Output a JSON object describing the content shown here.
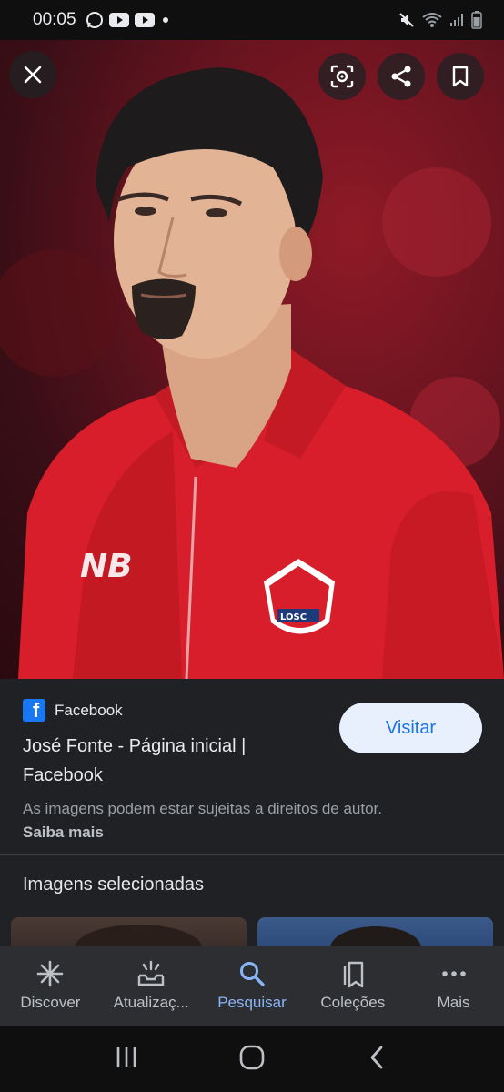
{
  "status_bar": {
    "time": "00:05",
    "app_icons": [
      "whatsapp-icon",
      "youtube-icon",
      "youtube-icon",
      "dot-icon"
    ],
    "right_icons": [
      "mute-icon",
      "wifi-icon",
      "signal-icon",
      "battery-icon"
    ]
  },
  "viewer": {
    "buttons": [
      "close-icon",
      "lens-icon",
      "share-icon",
      "bookmark-icon"
    ],
    "image_description_colors": {
      "jersey": "#d81e2a",
      "background": "#6a1420"
    }
  },
  "result": {
    "source_name": "Facebook",
    "title": "José Fonte - Página inicial | Facebook",
    "visit_label": "Visitar",
    "copyright_text": "As imagens podem estar sujeitas a direitos de autor.",
    "learn_more_label": "Saiba mais"
  },
  "related": {
    "heading": "Imagens selecionadas"
  },
  "bottom_nav": {
    "items": [
      {
        "label": "Discover",
        "icon": "asterisk-icon"
      },
      {
        "label": "Atualizaç...",
        "icon": "updates-icon"
      },
      {
        "label": "Pesquisar",
        "icon": "search-icon"
      },
      {
        "label": "Coleções",
        "icon": "collections-icon"
      },
      {
        "label": "Mais",
        "icon": "more-icon"
      }
    ],
    "active_index": 2
  },
  "colors": {
    "accent": "#8ab4f8",
    "visit_bg": "#e8f0fe",
    "visit_text": "#1a73e8"
  }
}
